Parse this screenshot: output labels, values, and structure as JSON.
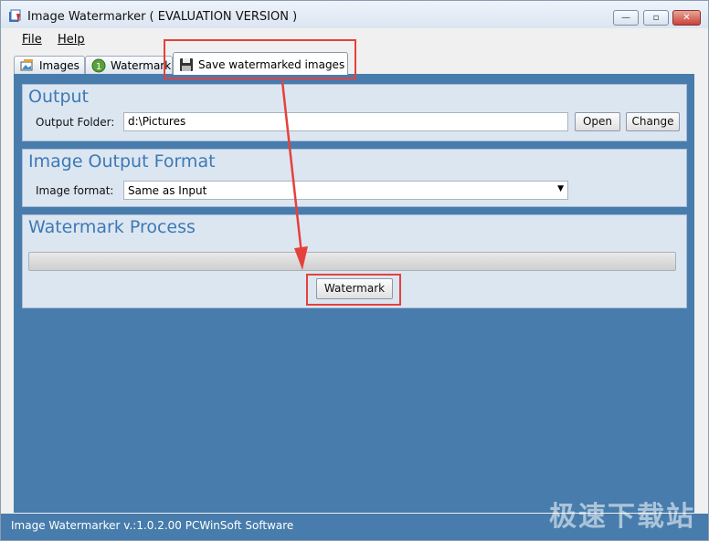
{
  "window": {
    "title": "Image Watermarker ( EVALUATION VERSION )",
    "controls": {
      "minimize": "—",
      "maximize": "▫",
      "close": "✕"
    }
  },
  "menu": {
    "file": "File",
    "help": "Help"
  },
  "tabs": [
    {
      "label": "Images",
      "icon": "images-icon"
    },
    {
      "label": "Watermark",
      "icon": "watermark-icon"
    },
    {
      "label": "Save watermarked images",
      "icon": "floppy-disk-icon",
      "active": true
    }
  ],
  "output": {
    "title": "Output",
    "folder_label": "Output Folder:",
    "folder_value": "d:\\Pictures",
    "open_label": "Open",
    "change_label": "Change"
  },
  "format": {
    "title": "Image Output Format",
    "label": "Image format:",
    "selected": "Same as Input"
  },
  "process": {
    "title": "Watermark Process",
    "progress": 0,
    "button_label": "Watermark"
  },
  "status": {
    "text": "Image Watermarker v.:1.0.2.00 PCWinSoft Software"
  },
  "site_watermark": "极速下载站",
  "colors": {
    "panel": "#477cac",
    "group": "#dce6f1",
    "heading": "#3d79b5",
    "highlight": "#e5413c"
  }
}
